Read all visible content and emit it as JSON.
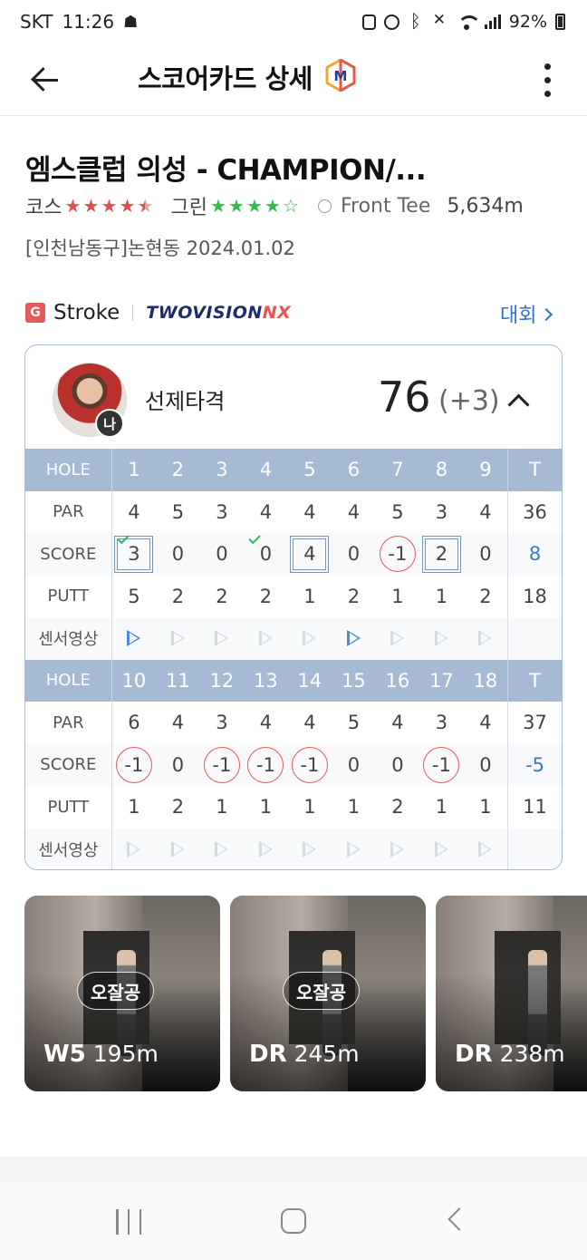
{
  "status_bar": {
    "carrier": "SKT",
    "time": "11:26",
    "battery": "92%"
  },
  "app_bar": {
    "title": "스코어카드 상세",
    "logo_letter": "M"
  },
  "course": {
    "name": "엠스클럽 의성 - CHAMPION/...",
    "course_label": "코스",
    "course_rating": 4.5,
    "green_label": "그린",
    "green_rating": 4,
    "tee": "Front Tee",
    "distance": "5,634m",
    "location_date": "[인천남동구]논현동 2024.01.02"
  },
  "mode": {
    "badge": "G",
    "label": "Stroke",
    "brand": "TWOVISION",
    "brand_suffix": "NX",
    "tournament_link": "대회"
  },
  "player": {
    "name": "선제타격",
    "me_badge": "나",
    "total": "76",
    "diff": "(+3)"
  },
  "scorecard": {
    "labels": {
      "hole": "HOLE",
      "par": "PAR",
      "score": "SCORE",
      "putt": "PUTT",
      "video": "센서영상",
      "total": "T"
    },
    "front": {
      "holes": [
        "1",
        "2",
        "3",
        "4",
        "5",
        "6",
        "7",
        "8",
        "9"
      ],
      "par": [
        "4",
        "5",
        "3",
        "4",
        "4",
        "4",
        "5",
        "3",
        "4"
      ],
      "score": [
        "3",
        "0",
        "0",
        "0",
        "4",
        "0",
        "-1",
        "2",
        "0"
      ],
      "score_mark": [
        "square",
        "",
        "",
        "",
        "square",
        "",
        "circle",
        "square",
        ""
      ],
      "check": [
        true,
        false,
        false,
        true,
        false,
        false,
        false,
        false,
        false
      ],
      "putt": [
        "5",
        "2",
        "2",
        "2",
        "1",
        "2",
        "1",
        "1",
        "2"
      ],
      "video": [
        true,
        false,
        false,
        false,
        false,
        true,
        false,
        false,
        false
      ],
      "par_total": "36",
      "score_total": "8",
      "putt_total": "18"
    },
    "back": {
      "holes": [
        "10",
        "11",
        "12",
        "13",
        "14",
        "15",
        "16",
        "17",
        "18"
      ],
      "par": [
        "6",
        "4",
        "3",
        "4",
        "4",
        "5",
        "4",
        "3",
        "4"
      ],
      "score": [
        "-1",
        "0",
        "-1",
        "-1",
        "-1",
        "0",
        "0",
        "-1",
        "0"
      ],
      "score_mark": [
        "circle",
        "",
        "circle",
        "circle",
        "circle",
        "",
        "",
        "circle",
        ""
      ],
      "check": [
        false,
        false,
        false,
        false,
        false,
        false,
        false,
        false,
        false
      ],
      "putt": [
        "1",
        "2",
        "1",
        "1",
        "1",
        "1",
        "2",
        "1",
        "1"
      ],
      "video": [
        false,
        false,
        false,
        false,
        false,
        false,
        false,
        false,
        false
      ],
      "par_total": "37",
      "score_total": "-5",
      "putt_total": "11"
    }
  },
  "shots": [
    {
      "badge": "오잘공",
      "club": "W5",
      "distance": "195m"
    },
    {
      "badge": "오잘공",
      "club": "DR",
      "distance": "245m"
    },
    {
      "badge": "",
      "club": "DR",
      "distance": "238m"
    }
  ],
  "colors": {
    "header_blue": "#a6bad3",
    "accent_blue": "#2f6fd6",
    "red_circle": "#e35b5b",
    "star_red": "#e84b4b",
    "star_green": "#2fbf4a"
  }
}
